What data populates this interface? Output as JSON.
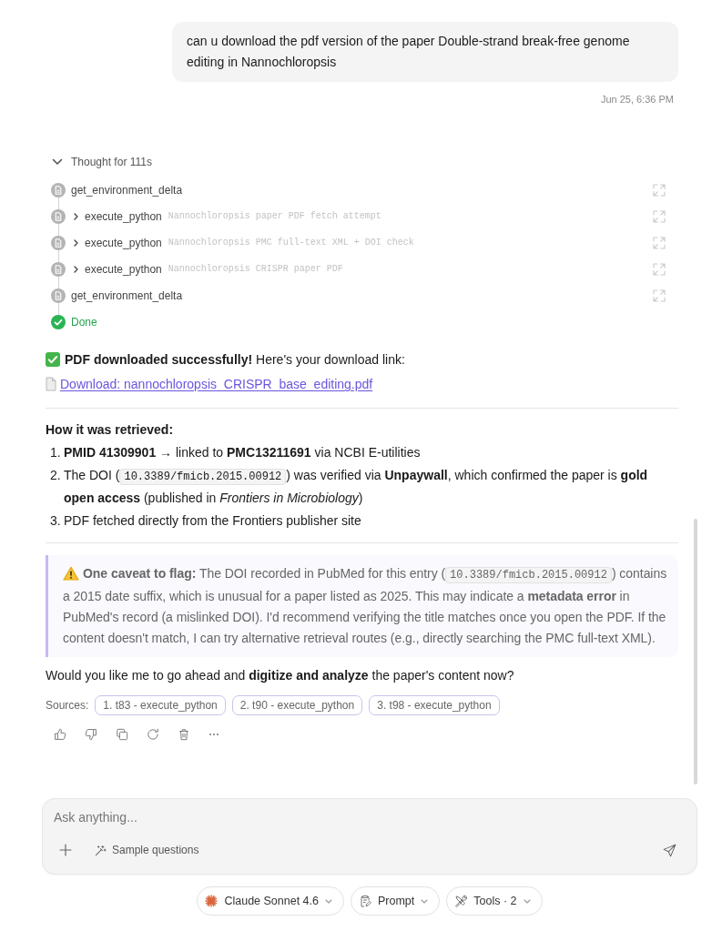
{
  "user_message": {
    "text": "can u download the pdf version of the paper Double-strand break-free genome editing in Nannochloropsis",
    "timestamp": "Jun 25, 6:36 PM"
  },
  "thought": {
    "label": "Thought for 111s",
    "expanded": true,
    "steps": [
      {
        "kind": "plain",
        "name": "get_environment_delta"
      },
      {
        "kind": "collapsible",
        "name": "execute_python",
        "detail": "Nannochloropsis paper PDF fetch attempt",
        "expanded": false
      },
      {
        "kind": "collapsible",
        "name": "execute_python",
        "detail": "Nannochloropsis PMC full-text XML + DOI check",
        "expanded": false
      },
      {
        "kind": "collapsible",
        "name": "execute_python",
        "detail": "Nannochloropsis CRISPR paper PDF",
        "expanded": false
      },
      {
        "kind": "plain",
        "name": "get_environment_delta"
      },
      {
        "kind": "done",
        "name": "Done"
      }
    ]
  },
  "answer": {
    "headline": "**PDF downloaded successfully!** Here's your download link:",
    "download_link": "Download: nannochloropsis_CRISPR_base_editing.pdf",
    "section_heading": "How it was retrieved:",
    "steps": [
      {
        "number": "1.",
        "parts": [
          {
            "kind": "text",
            "text": "**PMID 41309901** → linked to **PMC13211691** via NCBI E-utilities"
          }
        ]
      },
      {
        "number": "2.",
        "parts": [
          {
            "kind": "text",
            "text": "The DOI ("
          },
          {
            "kind": "code",
            "text": "10.3389/fmicb.2015.00912"
          },
          {
            "kind": "text",
            "text": ") was verified via **Unpaywall**, which confirmed the paper is **gold open access** (published in *Frontiers in Microbiology*)"
          }
        ]
      },
      {
        "number": "3.",
        "parts": [
          {
            "kind": "text",
            "text": "PDF fetched directly from the Frontiers publisher site"
          }
        ]
      }
    ],
    "callout": {
      "parts": [
        {
          "kind": "text",
          "text": "**One caveat to flag:** The DOI recorded in PubMed for this entry ("
        },
        {
          "kind": "code",
          "text": "10.3389/fmicb.2015.00912"
        },
        {
          "kind": "text",
          "text": ") contains a 2015 date suffix, which is unusual for a paper listed as 2025. This may indicate a **metadata error** in PubMed's record (a mislinked DOI). I'd recommend verifying the title matches once you open the PDF. If the content doesn't match, I can try alternative retrieval routes (e.g., directly searching the PMC full-text XML)."
        }
      ]
    },
    "closing": "Would you like me to go ahead and **digitize and analyze** the paper's content now?",
    "sources": {
      "label": "Sources:",
      "items": [
        "1. t83 - execute_python",
        "2. t90 - execute_python",
        "3. t98 - execute_python"
      ]
    }
  },
  "composer": {
    "placeholder": "Ask anything...",
    "sample_questions": "Sample questions"
  },
  "toolbar": [
    {
      "kind": "model",
      "label": "Claude Sonnet 4.6"
    },
    {
      "kind": "prompt",
      "label": "Prompt"
    },
    {
      "kind": "tools",
      "label": "Tools · 2"
    }
  ]
}
